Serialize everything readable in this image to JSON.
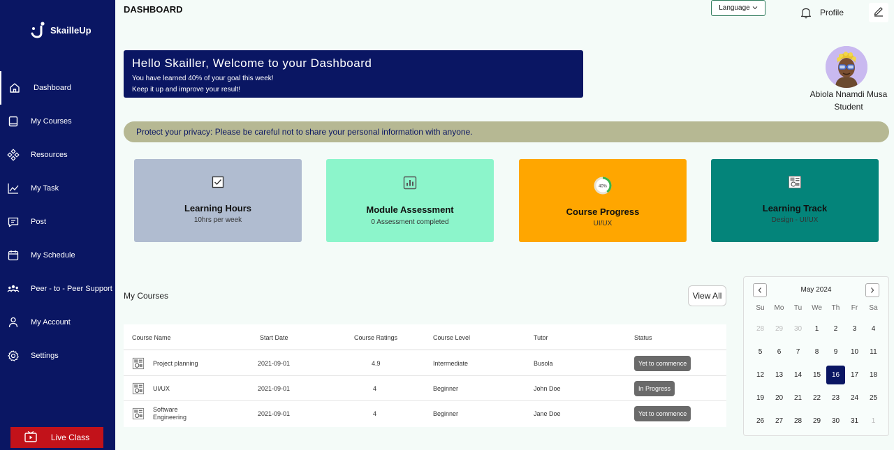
{
  "brand": {
    "name": "SkailleUp"
  },
  "sidebar": {
    "items": [
      {
        "label": "Dashboard",
        "icon": "home-icon"
      },
      {
        "label": "My Courses",
        "icon": "book-icon"
      },
      {
        "label": "Resources",
        "icon": "resources-icon"
      },
      {
        "label": "My Task",
        "icon": "chart-line-icon"
      },
      {
        "label": "Post",
        "icon": "message-icon"
      },
      {
        "label": "My Schedule",
        "icon": "calendar-icon"
      },
      {
        "label": "Peer - to - Peer Support",
        "icon": "people-icon"
      },
      {
        "label": "My Account",
        "icon": "user-icon"
      },
      {
        "label": "Settings",
        "icon": "gear-icon"
      }
    ],
    "live_class": "Live Class"
  },
  "header": {
    "title": "DASHBOARD",
    "language": "Language",
    "profile": "Profile"
  },
  "welcome": {
    "title": "Hello Skailler, Welcome to your Dashboard",
    "line1": "You have learned 40% of your goal this week!",
    "line2": "Keep it up and improve your result!"
  },
  "user": {
    "name": "Abiola Nnamdi Musa",
    "role": "Student"
  },
  "privacy": "Protect your privacy: Please be careful not to share your personal information with anyone.",
  "cards": [
    {
      "title": "Learning Hours",
      "subtitle": "10hrs per week",
      "color": "#b0bcd0",
      "icon": "checkbox-icon"
    },
    {
      "title": "Module Assessment",
      "subtitle": "0 Assessment completed",
      "color": "#8cf5cb",
      "icon": "bar-chart-icon"
    },
    {
      "title": "Course Progress",
      "subtitle": "UI/UX",
      "color": "#ffa600",
      "icon": "progress-ring-icon",
      "progress_label": "40%",
      "progress": 0.4
    },
    {
      "title": "Learning Track",
      "subtitle": "Design - UI/UX",
      "color": "#04847a",
      "icon": "track-icon"
    }
  ],
  "courses": {
    "title": "My Courses",
    "view_all": "View All",
    "headers": [
      "Course Name",
      "Start Date",
      "Course Ratings",
      "Course Level",
      "Tutor",
      "Status"
    ],
    "rows": [
      {
        "name": "Project planning",
        "start": "2021-09-01",
        "rating": "4.9",
        "level": "Intermediate",
        "tutor": "Busola",
        "status": "Yet to commence"
      },
      {
        "name": "UI/UX",
        "start": "2021-09-01",
        "rating": "4",
        "level": "Beginner",
        "tutor": "John Doe",
        "status": "In Progress"
      },
      {
        "name": "Software\nEngineering",
        "name_line1": "Software",
        "name_line2": "Engineering",
        "start": "2021-09-01",
        "rating": "4",
        "level": "Beginner",
        "tutor": "Jane Doe",
        "status": "Yet to commence"
      }
    ]
  },
  "calendar": {
    "month": "May 2024",
    "days_of_week": [
      "Su",
      "Mo",
      "Tu",
      "We",
      "Th",
      "Fr",
      "Sa"
    ],
    "selected": "16",
    "weeks": [
      [
        "28",
        "29",
        "30",
        "1",
        "2",
        "3",
        "4"
      ],
      [
        "5",
        "6",
        "7",
        "8",
        "9",
        "10",
        "11"
      ],
      [
        "12",
        "13",
        "14",
        "15",
        "16",
        "17",
        "18"
      ],
      [
        "19",
        "20",
        "21",
        "22",
        "23",
        "24",
        "25"
      ],
      [
        "26",
        "27",
        "28",
        "29",
        "30",
        "31",
        "1"
      ]
    ]
  },
  "colors": {
    "navy": "#0a1663",
    "live_red": "#c2121a",
    "privacy_bg": "#b6b893"
  }
}
